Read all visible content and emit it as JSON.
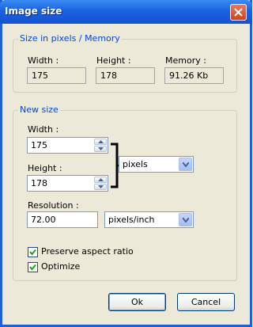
{
  "window": {
    "title": "Image size"
  },
  "current": {
    "group_title": "Size in pixels / Memory",
    "width_label": "Width :",
    "width_value": "175",
    "height_label": "Height :",
    "height_value": "178",
    "memory_label": "Memory :",
    "memory_value": "91.26 Kb"
  },
  "new_size": {
    "group_title": "New size",
    "width_label": "Width :",
    "width_value": "175",
    "height_label": "Height :",
    "height_value": "178",
    "unit_selected": "pixels",
    "resolution_label": "Resolution :",
    "resolution_value": "72.00",
    "resolution_unit_selected": "pixels/inch",
    "preserve_label": "Preserve aspect ratio",
    "preserve_checked": true,
    "optimize_label": "Optimize",
    "optimize_checked": true
  },
  "buttons": {
    "ok": "Ok",
    "cancel": "Cancel"
  }
}
